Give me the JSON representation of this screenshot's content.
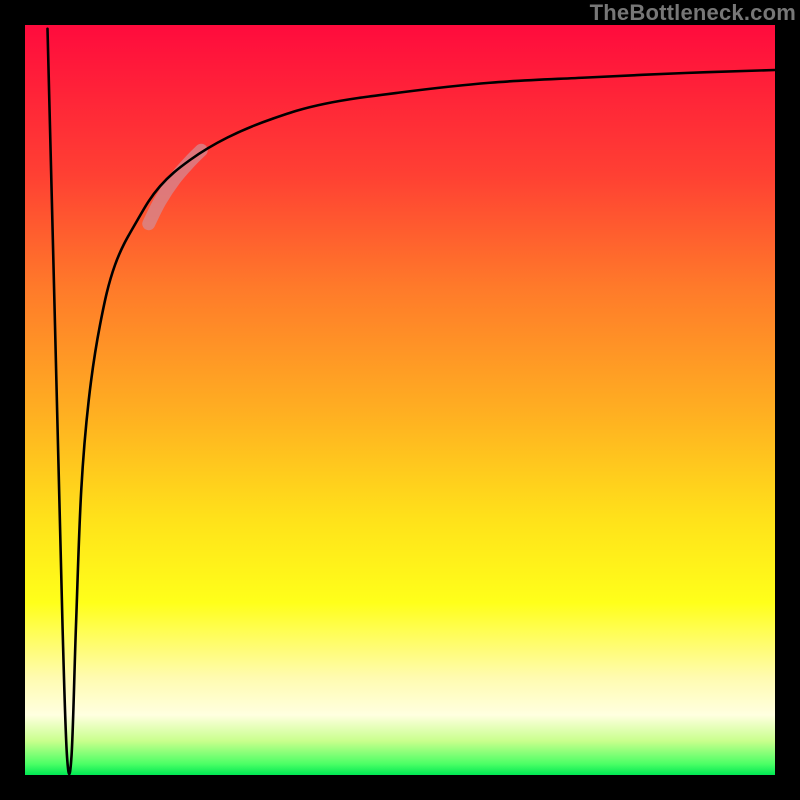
{
  "watermark": "TheBottleneck.com",
  "chart_data": {
    "type": "line",
    "title": "",
    "xlabel": "",
    "ylabel": "",
    "xlim": [
      0,
      100
    ],
    "ylim": [
      0,
      100
    ],
    "grid": false,
    "gradient_stops": [
      {
        "offset": 0.0,
        "color": "#ff0b3d"
      },
      {
        "offset": 0.2,
        "color": "#ff4033"
      },
      {
        "offset": 0.35,
        "color": "#ff7a2a"
      },
      {
        "offset": 0.52,
        "color": "#ffb021"
      },
      {
        "offset": 0.66,
        "color": "#ffe21a"
      },
      {
        "offset": 0.77,
        "color": "#ffff1a"
      },
      {
        "offset": 0.87,
        "color": "#fffbb0"
      },
      {
        "offset": 0.92,
        "color": "#ffffe0"
      },
      {
        "offset": 0.955,
        "color": "#c8ff8c"
      },
      {
        "offset": 0.985,
        "color": "#4dff66"
      },
      {
        "offset": 1.0,
        "color": "#00e853"
      }
    ],
    "series": [
      {
        "name": "bottleneck-curve",
        "description": "Black curve: sharp drop from top-left to a minimum near x≈6, then asymptotic rise toward y≈94 at large x.",
        "x": [
          3.0,
          4.0,
          5.0,
          5.6,
          6.2,
          6.8,
          7.5,
          8.5,
          10,
          12,
          15,
          18,
          22,
          27,
          33,
          40,
          50,
          62,
          75,
          88,
          100
        ],
        "y": [
          99.5,
          60,
          20,
          2.5,
          2.5,
          20,
          38,
          50,
          60,
          68,
          74,
          78.5,
          82,
          85,
          87.5,
          89.5,
          91,
          92.3,
          93,
          93.6,
          94
        ]
      },
      {
        "name": "highlight-segment",
        "description": "Thick semi-transparent pinkish highlight over part of the rising curve, roughly x≈17–23.",
        "x": [
          16.5,
          18,
          20,
          22,
          23.5
        ],
        "y": [
          73.5,
          76.5,
          79.5,
          81.8,
          83.3
        ]
      }
    ]
  }
}
